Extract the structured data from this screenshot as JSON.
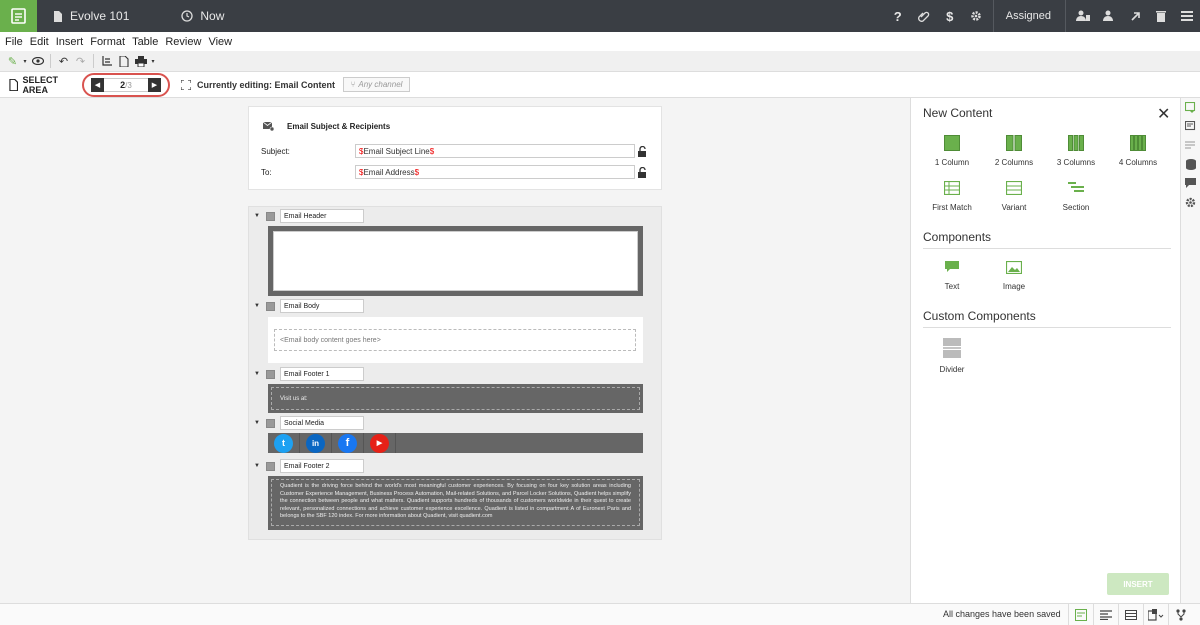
{
  "app": {
    "doc_title": "Evolve 101",
    "time_label": "Now",
    "status": "Assigned"
  },
  "menu": [
    "File",
    "Edit",
    "Insert",
    "Format",
    "Table",
    "Review",
    "View"
  ],
  "select_area": {
    "label": "SELECT AREA",
    "current_page": "2",
    "total_pages": "/3",
    "editing_label": "Currently editing: Email Content",
    "channel_placeholder": "Any channel"
  },
  "subject_card": {
    "title": "Email Subject & Recipients",
    "subject_label": "Subject:",
    "subject_value": "Email Subject Line",
    "to_label": "To:",
    "to_value": "Email Address",
    "variable_marker": "$"
  },
  "sections": {
    "header": "Email Header",
    "body": "Email Body",
    "body_placeholder": "<Email body content goes here>",
    "footer1": "Email Footer 1",
    "footer1_text": "Visit us at:",
    "social": "Social Media",
    "footer2": "Email Footer 2",
    "footer2_text": "Quadient is the driving force behind the world's most meaningful customer experiences. By focusing on four key solution areas including Customer Experience Management, Business Process Automation, Mail-related Solutions, and Parcel Locker Solutions, Quadient helps simplify the connection between people and what matters. Quadient supports hundreds of thousands of customers worldwide in their quest to create relevant, personalized connections and achieve customer experience excellence. Quadient is listed in compartment A of Euronext Paris and belongs to the SBF 120 index. For more information about Quadient, visit quadient.com"
  },
  "social_icons": [
    {
      "name": "twitter",
      "color": "#1da1f2",
      "glyph": "t"
    },
    {
      "name": "linkedin",
      "color": "#0a66c2",
      "glyph": "in"
    },
    {
      "name": "facebook",
      "color": "#1877f2",
      "glyph": "f"
    },
    {
      "name": "youtube",
      "color": "#e62117",
      "glyph": "▶"
    }
  ],
  "panel": {
    "title": "New Content",
    "layouts": [
      "1 Column",
      "2 Columns",
      "3 Columns",
      "4 Columns",
      "First Match",
      "Variant",
      "Section"
    ],
    "components_title": "Components",
    "components": [
      "Text",
      "Image"
    ],
    "custom_title": "Custom Components",
    "custom": [
      "Divider"
    ],
    "insert_label": "INSERT"
  },
  "status": {
    "saved": "All changes have been saved"
  },
  "colors": {
    "accent": "#6ab04c",
    "topbar": "#3a3e44",
    "highlight": "#d9534f"
  }
}
